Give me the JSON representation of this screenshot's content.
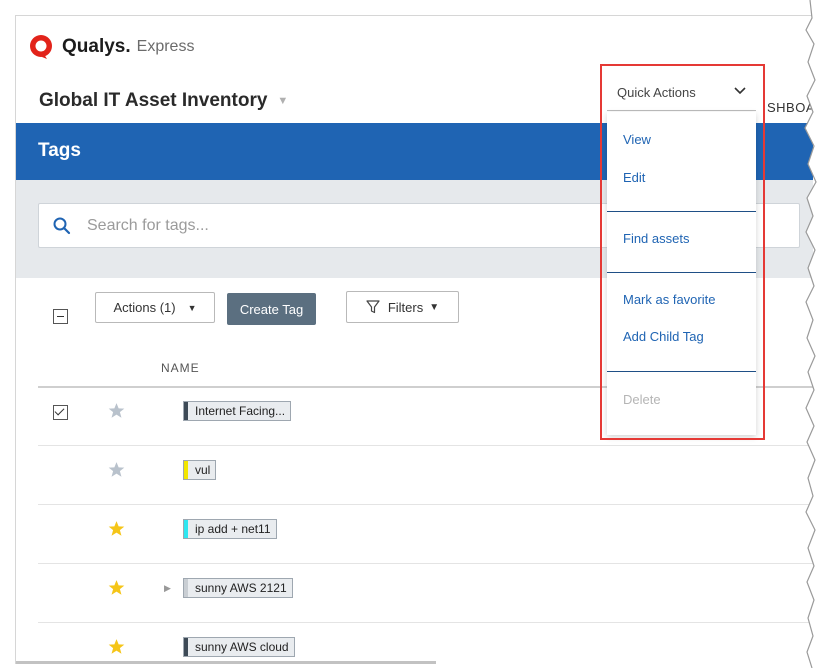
{
  "header": {
    "brand_name": "Qualys.",
    "brand_sub": "Express",
    "app_title": "Global IT Asset Inventory",
    "dashboard_partial": "SHBOA"
  },
  "tags_bar": {
    "title": "Tags"
  },
  "search": {
    "placeholder": "Search for tags..."
  },
  "toolbar": {
    "actions_label": "Actions (1)",
    "create_label": "Create Tag",
    "filters_label": "Filters"
  },
  "table": {
    "column_name": "NAME",
    "rows": [
      {
        "name": "Internet Facing...",
        "checked": true,
        "favorite": false,
        "color": "#3d4a56",
        "expandable": false
      },
      {
        "name": "vul",
        "checked": false,
        "favorite": false,
        "color": "#f2e600",
        "expandable": false
      },
      {
        "name": "ip add + net11",
        "checked": false,
        "favorite": true,
        "color": "#2ee6f0",
        "expandable": false
      },
      {
        "name": "sunny AWS 2121",
        "checked": false,
        "favorite": true,
        "color": "#c9ced3",
        "expandable": true
      },
      {
        "name": "sunny AWS cloud",
        "checked": false,
        "favorite": true,
        "color": "#3d4a56",
        "expandable": false
      }
    ]
  },
  "quick_actions": {
    "label": "Quick Actions",
    "items": [
      "View",
      "Edit",
      "Find assets",
      "Mark as favorite",
      "Add Child Tag",
      "Delete"
    ]
  },
  "colors": {
    "accent_blue": "#1f64b3",
    "highlight_red": "#e53935",
    "star_gold": "#f5c518",
    "star_gray": "#b9c2cc"
  }
}
